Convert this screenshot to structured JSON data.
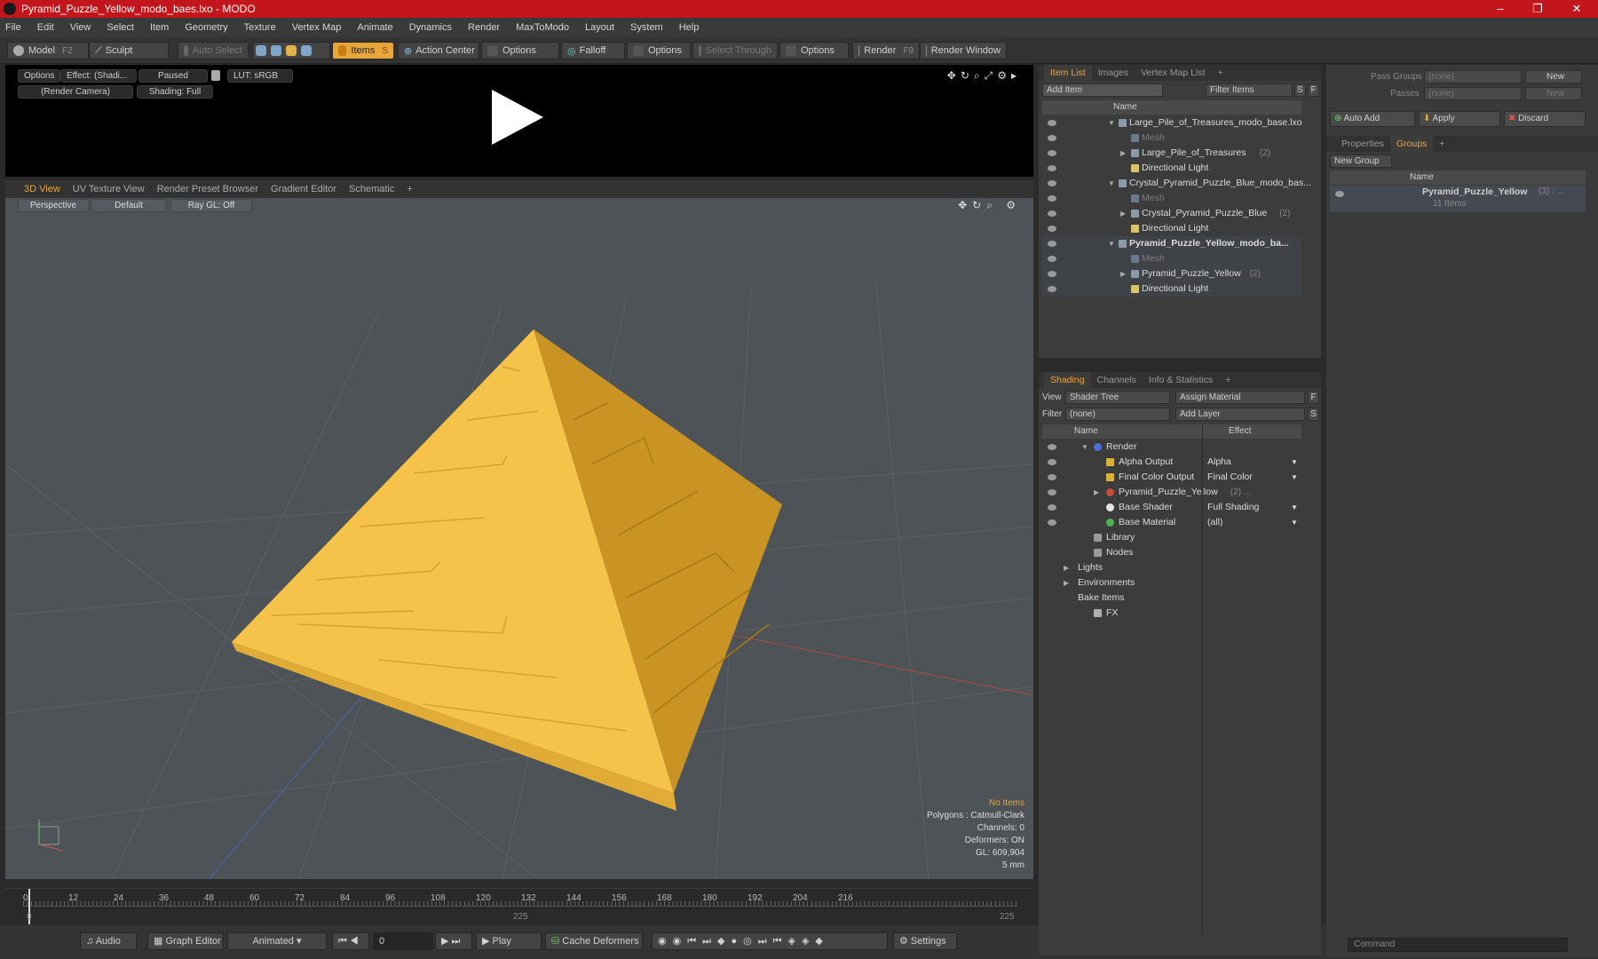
{
  "window": {
    "title": "Pyramid_Puzzle_Yellow_modo_baes.lxo - MODO",
    "min": "–",
    "max": "❐",
    "close": "✕"
  },
  "menu": [
    "File",
    "Edit",
    "View",
    "Select",
    "Item",
    "Geometry",
    "Texture",
    "Vertex Map",
    "Animate",
    "Dynamics",
    "Render",
    "MaxToModo",
    "Layout",
    "System",
    "Help"
  ],
  "toolbar": {
    "model": "Model",
    "model_key": "F2",
    "sculpt": "Sculpt",
    "auto_select": "Auto Select",
    "items": "Items",
    "items_key": "S",
    "action_center": "Action Center",
    "options1": "Options",
    "falloff": "Falloff",
    "options2": "Options",
    "select_through": "Select Through",
    "options3": "Options",
    "render": "Render",
    "render_key": "F9",
    "render_window": "Render Window"
  },
  "preview": {
    "options": "Options",
    "effect": "Effect: (Shadi...",
    "paused": "Paused",
    "lut": "LUT: sRGB",
    "camera": "(Render Camera)",
    "shading": "Shading: Full"
  },
  "viewport_tabs": [
    "3D View",
    "UV Texture View",
    "Render Preset Browser",
    "Gradient Editor",
    "Schematic",
    "+"
  ],
  "viewport": {
    "perspective": "Perspective",
    "default": "Default",
    "raygl": "Ray GL: Off",
    "stats": {
      "items": "No Items",
      "polygons": "Polygons : Catmull-Clark",
      "channels": "Channels: 0",
      "deformers": "Deformers: ON",
      "gl": "GL: 609,904",
      "unit": "5 mm"
    }
  },
  "timeline": {
    "ticks": [
      "0",
      "12",
      "24",
      "36",
      "48",
      "60",
      "72",
      "84",
      "96",
      "108",
      "120",
      "132",
      "144",
      "156",
      "168",
      "180",
      "192",
      "204",
      "216"
    ],
    "start": "0",
    "mid": "225",
    "end": "225"
  },
  "bottom": {
    "audio": "Audio",
    "graph_editor": "Graph Editor",
    "animated": "Animated",
    "frame": "0",
    "play": "Play",
    "cache": "Cache Deformers",
    "settings": "Settings"
  },
  "item_list": {
    "tabs": [
      "Item List",
      "Images",
      "Vertex Map List",
      "+"
    ],
    "add_item": "Add Item",
    "filter": "Filter Items",
    "s": "S",
    "f": "F",
    "col_name": "Name",
    "rows": [
      {
        "label": "Large_Pile_of_Treasures_modo_base.lxo",
        "indent": 0,
        "type": "scene",
        "bold": false,
        "dim": false,
        "arrow": "▼",
        "count": ""
      },
      {
        "label": "Mesh",
        "indent": 1,
        "type": "mesh",
        "bold": false,
        "dim": true,
        "arrow": "",
        "count": ""
      },
      {
        "label": "Large_Pile_of_Treasures",
        "indent": 1,
        "type": "group",
        "bold": false,
        "dim": false,
        "arrow": "▶",
        "count": "(2)"
      },
      {
        "label": "Directional Light",
        "indent": 1,
        "type": "light",
        "bold": false,
        "dim": false,
        "arrow": "",
        "count": ""
      },
      {
        "label": "Crystal_Pyramid_Puzzle_Blue_modo_bas...",
        "indent": 0,
        "type": "scene",
        "bold": false,
        "dim": false,
        "arrow": "▼",
        "count": ""
      },
      {
        "label": "Mesh",
        "indent": 1,
        "type": "mesh",
        "bold": false,
        "dim": true,
        "arrow": "",
        "count": ""
      },
      {
        "label": "Crystal_Pyramid_Puzzle_Blue",
        "indent": 1,
        "type": "group",
        "bold": false,
        "dim": false,
        "arrow": "▶",
        "count": "(2)"
      },
      {
        "label": "Directional Light",
        "indent": 1,
        "type": "light",
        "bold": false,
        "dim": false,
        "arrow": "",
        "count": ""
      },
      {
        "label": "Pyramid_Puzzle_Yellow_modo_ba...",
        "indent": 0,
        "type": "scene",
        "bold": true,
        "dim": false,
        "arrow": "▼",
        "count": ""
      },
      {
        "label": "Mesh",
        "indent": 1,
        "type": "mesh",
        "bold": false,
        "dim": true,
        "arrow": "",
        "count": ""
      },
      {
        "label": "Pyramid_Puzzle_Yellow",
        "indent": 1,
        "type": "group",
        "bold": false,
        "dim": false,
        "arrow": "▶",
        "count": "(2)"
      },
      {
        "label": "Directional Light",
        "indent": 1,
        "type": "light",
        "bold": false,
        "dim": false,
        "arrow": "",
        "count": ""
      }
    ]
  },
  "shading": {
    "tabs": [
      "Shading",
      "Channels",
      "Info & Statistics",
      "+"
    ],
    "view_label": "View",
    "view_value": "Shader Tree",
    "assign": "Assign Material",
    "f": "F",
    "filter_label": "Filter",
    "filter_value": "(none)",
    "add_layer": "Add Layer",
    "s": "S",
    "col_name": "Name",
    "col_effect": "Effect",
    "rows": [
      {
        "label": "Render",
        "effect": "",
        "indent": 0,
        "arrow": "▼",
        "icon": "sphere-blue",
        "eye": true,
        "count": ""
      },
      {
        "label": "Alpha Output",
        "effect": "Alpha",
        "indent": 1,
        "arrow": "",
        "icon": "output",
        "eye": true,
        "count": ""
      },
      {
        "label": "Final Color Output",
        "effect": "Final Color",
        "indent": 1,
        "arrow": "",
        "icon": "output",
        "eye": true,
        "count": ""
      },
      {
        "label": "Pyramid_Puzzle_Yellow",
        "effect": "",
        "indent": 1,
        "arrow": "▶",
        "icon": "sphere-red",
        "eye": true,
        "count": "(2) ..."
      },
      {
        "label": "Base Shader",
        "effect": "Full Shading",
        "indent": 1,
        "arrow": "",
        "icon": "sphere-white",
        "eye": true,
        "count": ""
      },
      {
        "label": "Base Material",
        "effect": "(all)",
        "indent": 1,
        "arrow": "",
        "icon": "sphere-green",
        "eye": true,
        "count": ""
      },
      {
        "label": "Library",
        "effect": "",
        "indent": 0,
        "arrow": "",
        "icon": "folder",
        "eye": false,
        "count": ""
      },
      {
        "label": "Nodes",
        "effect": "",
        "indent": 0,
        "arrow": "",
        "icon": "folder",
        "eye": false,
        "count": ""
      },
      {
        "label": "Lights",
        "effect": "",
        "indent": -1,
        "arrow": "▶",
        "icon": "",
        "eye": false,
        "count": ""
      },
      {
        "label": "Environments",
        "effect": "",
        "indent": -1,
        "arrow": "▶",
        "icon": "",
        "eye": false,
        "count": ""
      },
      {
        "label": "Bake Items",
        "effect": "",
        "indent": -1,
        "arrow": "",
        "icon": "",
        "eye": false,
        "count": ""
      },
      {
        "label": "FX",
        "effect": "",
        "indent": 0,
        "arrow": "",
        "icon": "fx",
        "eye": false,
        "count": ""
      }
    ]
  },
  "groups": {
    "pass_groups": "Pass Groups",
    "passes": "Passes",
    "none1": "(none)",
    "none2": "(none)",
    "new1": "New",
    "new2": "New",
    "auto_add": "Auto Add",
    "apply": "Apply",
    "discard": "Discard",
    "tabs": [
      "Properties",
      "Groups",
      "+"
    ],
    "new_group": "New Group",
    "col_name": "Name",
    "group_name": "Pyramid_Puzzle_Yellow",
    "group_count": "(3) : ...",
    "group_items": "11 Items"
  },
  "command": {
    "placeholder": "Command"
  },
  "colors": {
    "accent": "#e8a53a",
    "titlebar": "#c3161c",
    "pyramid_light": "#f5c24a",
    "pyramid_dark": "#c99424"
  }
}
